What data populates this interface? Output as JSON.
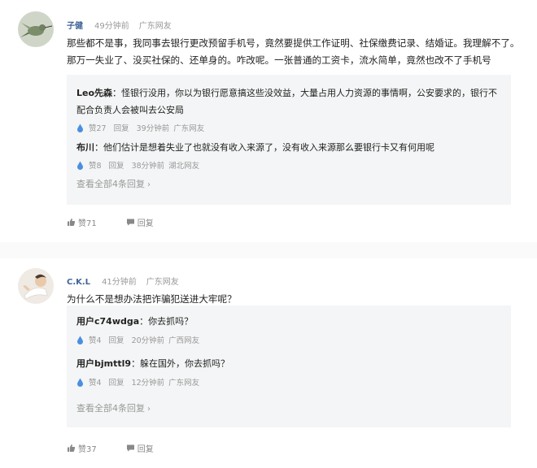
{
  "comments": [
    {
      "username": "子健",
      "time": "49分钟前",
      "location": "广东网友",
      "text": "那些都不是事，我同事去银行更改预留手机号，竟然要提供工作证明、社保缴费记录、结婚证。我理解不了。那万一失业了、没买社保的、还单身的。咋改呢。一张普通的工资卡，流水简单，竟然也改不了手机号",
      "replies": [
        {
          "name": "Leo先森",
          "text": "：怪银行没用，你以为银行愿意搞这些没效益，大量占用人力资源的事情啊，公安要求的，银行不配合负责人会被叫去公安局",
          "likes": "赞27",
          "reply_label": "回复",
          "time": "39分钟前",
          "location": "广东网友"
        },
        {
          "name": "布川",
          "text": "：他们估计是想着失业了也就没有收入来源了，没有收入来源那么要银行卡又有何用呢",
          "likes": "赞8",
          "reply_label": "回复",
          "time": "38分钟前",
          "location": "湖北网友"
        }
      ],
      "view_all": "查看全部4条回复",
      "likes": "赞71",
      "reply_label": "回复"
    },
    {
      "username": "C.K.L",
      "time": "41分钟前",
      "location": "广东网友",
      "text": "为什么不是想办法把诈骗犯送进大牢呢？",
      "replies": [
        {
          "name": "用户c74wdga",
          "text": "：你去抓吗？",
          "likes": "赞4",
          "reply_label": "回复",
          "time": "20分钟前",
          "location": "广西网友"
        },
        {
          "name": "用户bjmttl9",
          "text": "：躲在国外，你去抓吗？",
          "likes": "赞4",
          "reply_label": "回复",
          "time": "12分钟前",
          "location": "广东网友"
        }
      ],
      "view_all": "查看全部4条回复",
      "likes": "赞37",
      "reply_label": "回复"
    }
  ],
  "icons": {
    "like": "thumbs-up-icon",
    "reply": "speech-bubble-icon",
    "reply_like": "water-drop-icon",
    "chevron": "chevron-right-icon"
  },
  "colors": {
    "username": "#406599",
    "meta": "#999999",
    "reply_box": "#f4f5f6",
    "like_drop": "#4a8fe0"
  }
}
